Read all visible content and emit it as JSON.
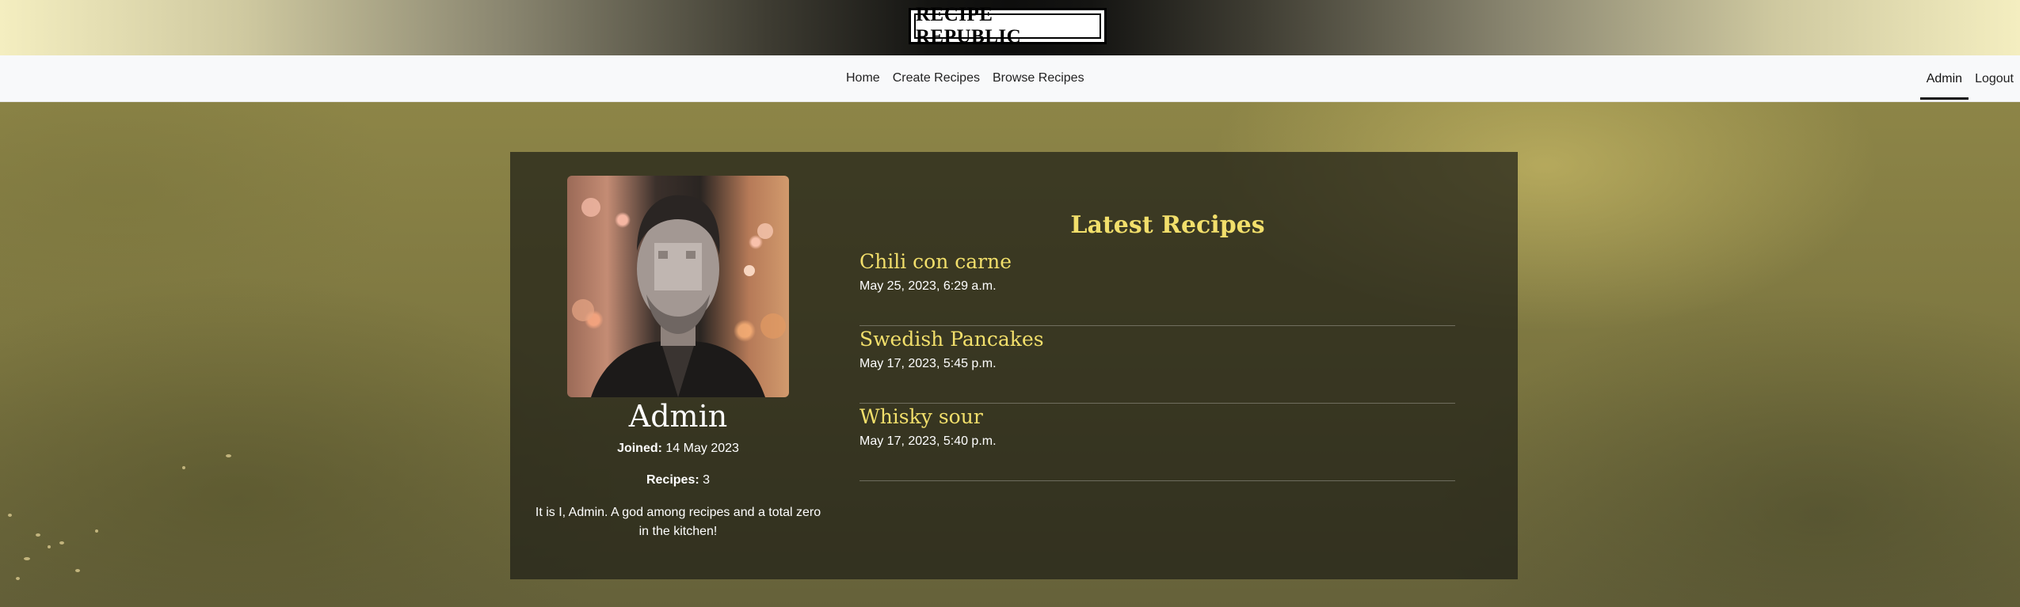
{
  "brand": {
    "logo_text": "RECIPE REPUBLIC"
  },
  "nav": {
    "main": [
      {
        "label": "Home"
      },
      {
        "label": "Create Recipes"
      },
      {
        "label": "Browse Recipes"
      }
    ],
    "user": [
      {
        "label": "Admin",
        "active": true
      },
      {
        "label": "Logout",
        "active": false
      }
    ]
  },
  "profile": {
    "name": "Admin",
    "joined_label": "Joined:",
    "joined_value": "14 May 2023",
    "recipes_label": "Recipes:",
    "recipes_value": "3",
    "bio": "It is I, Admin. A god among recipes and a total zero in the kitchen!"
  },
  "latest": {
    "heading": "Latest Recipes",
    "recipes": [
      {
        "title": "Chili con carne",
        "date": "May 25, 2023, 6:29 a.m."
      },
      {
        "title": "Swedish Pancakes",
        "date": "May 17, 2023, 5:45 p.m."
      },
      {
        "title": "Whisky sour",
        "date": "May 17, 2023, 5:40 p.m."
      }
    ]
  },
  "colors": {
    "accent_gold": "#f2df6b",
    "card_bg": "#1e1e16",
    "navbar_bg": "#f8f9fa"
  }
}
